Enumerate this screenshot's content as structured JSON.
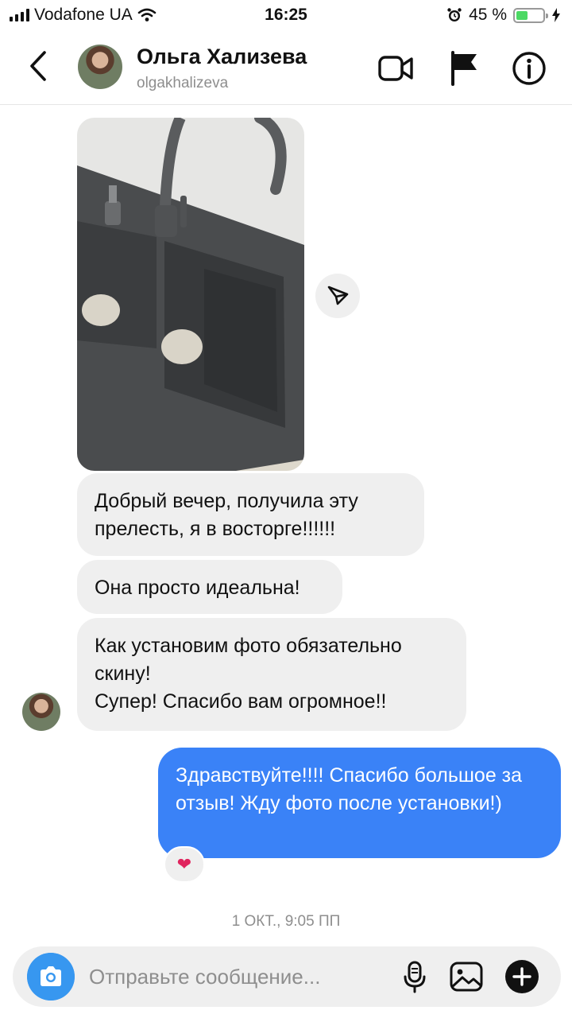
{
  "status_bar": {
    "carrier": "Vodafone UA",
    "time": "16:25",
    "battery_percent": "45 %",
    "battery_level": 0.45
  },
  "header": {
    "name": "Ольга Хализева",
    "handle": "olgakhalizeva"
  },
  "messages": {
    "incoming_1": "Добрый вечер,  получила эту прелесть, я в восторге!!!!!!",
    "incoming_2": "Она просто идеальна!",
    "incoming_3_line1": "Как установим фото обязательно скину!",
    "incoming_3_line2": "Супер! Спасибо вам огромное!!",
    "outgoing_1": "Здравствуйте!!!! Спасибо большое за отзыв! Жду фото после установки!)",
    "reaction": "❤"
  },
  "timestamp": "1 ОКТ., 9:05 ПП",
  "composer": {
    "placeholder": "Отправьте сообщение..."
  },
  "colors": {
    "outgoing_bubble": "#3a82f7",
    "incoming_bubble": "#efefef",
    "camera_button": "#3797f0"
  },
  "icons": [
    "back-icon",
    "video-call-icon",
    "flag-icon",
    "info-icon",
    "share-icon",
    "camera-icon",
    "microphone-icon",
    "gallery-icon",
    "plus-icon"
  ]
}
